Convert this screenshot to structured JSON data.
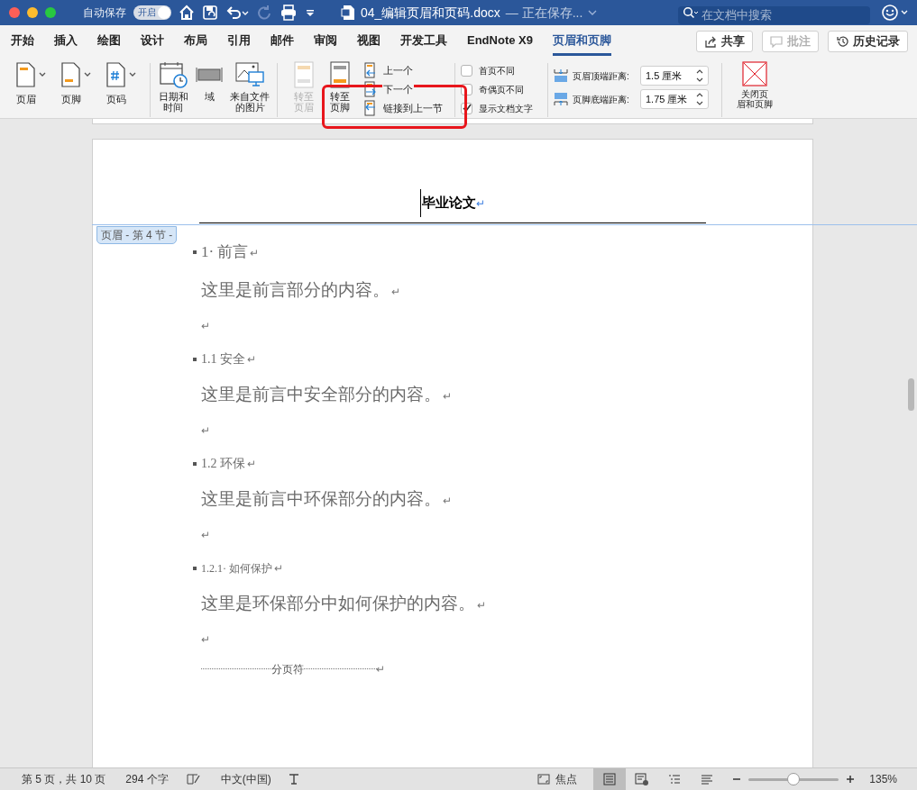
{
  "title_bar": {
    "autosave_label": "自动保存",
    "autosave": {
      "label": "开启",
      "on": true
    },
    "title": "04_编辑页眉和页码.docx",
    "status": "— 正在保存...",
    "search": {
      "placeholder": "在文档中搜索"
    }
  },
  "tabs": [
    {
      "label": "开始",
      "selected": false
    },
    {
      "label": "插入",
      "selected": false
    },
    {
      "label": "绘图",
      "selected": false
    },
    {
      "label": "设计",
      "selected": false
    },
    {
      "label": "布局",
      "selected": false
    },
    {
      "label": "引用",
      "selected": false
    },
    {
      "label": "邮件",
      "selected": false
    },
    {
      "label": "审阅",
      "selected": false
    },
    {
      "label": "视图",
      "selected": false
    },
    {
      "label": "开发工具",
      "selected": false
    },
    {
      "label": "EndNote X9",
      "selected": false
    },
    {
      "label": "页眉和页脚",
      "selected": true
    }
  ],
  "top_buttons": [
    {
      "kind": "share",
      "label": "共享",
      "disabled": false
    },
    {
      "kind": "comment",
      "label": "批注",
      "disabled": true
    },
    {
      "kind": "history",
      "label": "历史记录",
      "disabled": false
    }
  ],
  "ribbon": {
    "insert_buttons": [
      {
        "kind": "header",
        "label": "页眉"
      },
      {
        "kind": "footer",
        "label": "页脚"
      },
      {
        "kind": "page_number",
        "label": "页码"
      }
    ],
    "field_buttons": [
      {
        "kind": "date",
        "label_lines": [
          "日期和",
          "时间"
        ]
      },
      {
        "kind": "field",
        "label_lines": [
          "域"
        ]
      },
      {
        "kind": "image",
        "label_lines": [
          "来自文件",
          "的图片"
        ]
      }
    ],
    "goto_buttons": [
      {
        "kind": "header",
        "label_lines": [
          "转至",
          "页眉"
        ],
        "disabled": true
      },
      {
        "kind": "footer",
        "label_lines": [
          "转至",
          "页脚"
        ],
        "disabled": false
      }
    ],
    "nav_items": [
      {
        "kind": "previous",
        "label": "上一个"
      },
      {
        "kind": "next",
        "label": "下一个"
      },
      {
        "kind": "link",
        "label": "链接到上一节"
      }
    ],
    "options": [
      {
        "label": "首页不同",
        "checked": false
      },
      {
        "label": "奇偶页不同",
        "checked": false
      },
      {
        "label": "显示文档文字",
        "checked": true
      }
    ],
    "positions": [
      {
        "kind": "top",
        "label": "页眉顶端距离:",
        "value": "1.5 厘米"
      },
      {
        "kind": "bottom",
        "label": "页脚底端距离:",
        "value": "1.75 厘米"
      }
    ],
    "close_button": {
      "label_lines": [
        "关闭页",
        "眉和页脚"
      ]
    }
  },
  "document": {
    "header": {
      "text": "毕业论文",
      "mark": "↵",
      "tag": "页眉 - 第 4 节 -"
    },
    "paragraphs": [
      {
        "kind": "heading1",
        "text": "1· 前言",
        "mark": "↵"
      },
      {
        "kind": "body",
        "text": "这里是前言部分的内容。",
        "mark": "↵"
      },
      {
        "kind": "empty",
        "mark": "↵"
      },
      {
        "kind": "heading2",
        "text": "1.1 安全",
        "mark": "↵"
      },
      {
        "kind": "body",
        "text": "这里是前言中安全部分的内容。",
        "mark": "↵"
      },
      {
        "kind": "empty",
        "mark": "↵"
      },
      {
        "kind": "heading2",
        "text": "1.2 环保",
        "mark": "↵"
      },
      {
        "kind": "body",
        "text": "这里是前言中环保部分的内容。",
        "mark": "↵"
      },
      {
        "kind": "empty",
        "mark": "↵"
      },
      {
        "kind": "heading3",
        "text": "1.2.1· 如何保护",
        "mark": "↵"
      },
      {
        "kind": "body",
        "text": "这里是环保部分中如何保护的内容。",
        "mark": "↵"
      },
      {
        "kind": "empty",
        "mark": "↵"
      },
      {
        "kind": "page_break",
        "text": "分页符",
        "mark": "↵"
      }
    ]
  },
  "status_bar": {
    "page": "第 5 页，共 10 页",
    "words": "294 个字",
    "language": "中文(中国)",
    "focus": "焦点",
    "views": [
      {
        "kind": "print",
        "selected": true
      },
      {
        "kind": "web",
        "selected": false
      },
      {
        "kind": "outline",
        "selected": false
      },
      {
        "kind": "draft",
        "selected": false
      }
    ],
    "zoom": {
      "level": 0.5,
      "reading": "135%"
    }
  }
}
